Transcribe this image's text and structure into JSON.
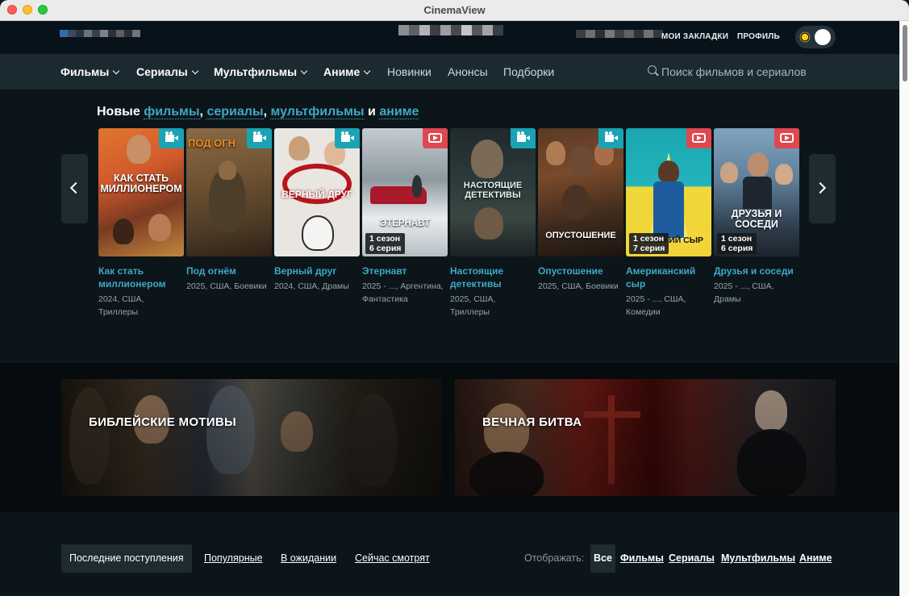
{
  "window": {
    "title": "CinemaView"
  },
  "topbar": {
    "bookmarks": "МОИ ЗАКЛАДКИ",
    "profile": "ПРОФИЛЬ"
  },
  "nav": {
    "items": [
      {
        "label": "Фильмы",
        "dropdown": true
      },
      {
        "label": "Сериалы",
        "dropdown": true
      },
      {
        "label": "Мультфильмы",
        "dropdown": true
      },
      {
        "label": "Аниме",
        "dropdown": true
      },
      {
        "label": "Новинки",
        "dropdown": false
      },
      {
        "label": "Анонсы",
        "dropdown": false
      },
      {
        "label": "Подборки",
        "dropdown": false
      }
    ],
    "search_placeholder": "Поиск фильмов и сериалов"
  },
  "new_section": {
    "prefix": "Новые",
    "link_films": "фильмы",
    "sep1": ",",
    "link_series": "сериалы",
    "sep2": ",",
    "link_cartoons": "мультфильмы",
    "conj": "и",
    "link_anime": "аниме",
    "cards": [
      {
        "title": "Как стать миллионером",
        "meta": "2024, США, Триллеры",
        "badge": "camera-icon",
        "poster_text": "КАК СТАТЬ МИЛЛИОНЕРОМ",
        "season": "",
        "episode": ""
      },
      {
        "title": "Под огнём",
        "meta": "2025, США, Боевики",
        "badge": "camera-icon",
        "poster_text": "ПОД ОГН",
        "season": "",
        "episode": ""
      },
      {
        "title": "Верный друг",
        "meta": "2024, США, Драмы",
        "badge": "camera-icon",
        "poster_text": "ВЕРНЫЙ ДРУГ",
        "season": "",
        "episode": ""
      },
      {
        "title": "Этернавт",
        "meta": "2025 - ..., Аргентина, Фантастика",
        "badge": "tv-play-icon",
        "poster_text": "ЭТЕРНАВТ",
        "season": "1 сезон",
        "episode": "6 серия"
      },
      {
        "title": "Настоящие детективы",
        "meta": "2025, США, Триллеры",
        "badge": "camera-icon",
        "poster_text": "НАСТОЯЩИЕ ДЕТЕКТИВЫ",
        "season": "",
        "episode": ""
      },
      {
        "title": "Опустошение",
        "meta": "2025, США, Боевики",
        "badge": "camera-icon",
        "poster_text": "ОПУСТОШЕНИЕ",
        "season": "",
        "episode": ""
      },
      {
        "title": "Американский сыр",
        "meta": "2025 - ..., США, Комедии",
        "badge": "tv-play-icon",
        "poster_text": "АНСКИЙ СЫР",
        "season": "1 сезон",
        "episode": "7 серия"
      },
      {
        "title": "Друзья и соседи",
        "meta": "2025 - ..., США, Драмы",
        "badge": "tv-play-icon",
        "poster_text": "ДРУЗЬЯ И СОСЕДИ",
        "season": "1 сезон",
        "episode": "6 серия"
      }
    ]
  },
  "collections": [
    {
      "title": "БИБЛЕЙСКИЕ МОТИВЫ"
    },
    {
      "title": "ВЕЧНАЯ БИТВА"
    }
  ],
  "bottom": {
    "tabs": [
      "Последние поступления",
      "Популярные",
      "В ожидании",
      "Сейчас смотрят"
    ],
    "filter_label": "Отображать:",
    "filters": [
      "Все",
      "Фильмы",
      "Сериалы",
      "Мультфильмы",
      "Аниме"
    ]
  },
  "colors": {
    "accent": "#3fa7c6",
    "badge_film": "#1aa3b4",
    "badge_series": "#e0484f"
  }
}
